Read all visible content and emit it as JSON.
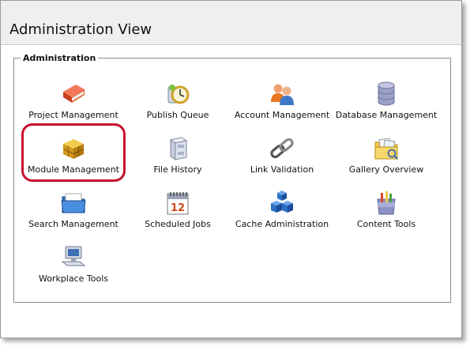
{
  "header": {
    "title": "Administration View"
  },
  "group": {
    "legend": "Administration"
  },
  "tools": [
    {
      "label": "Project Management",
      "icon": "book-icon"
    },
    {
      "label": "Publish Queue",
      "icon": "clock-icon"
    },
    {
      "label": "Account Management",
      "icon": "users-icon"
    },
    {
      "label": "Database Management",
      "icon": "database-icon"
    },
    {
      "label": "Module Management",
      "icon": "module-boxes-icon"
    },
    {
      "label": "File History",
      "icon": "file-cabinet-icon"
    },
    {
      "label": "Link Validation",
      "icon": "chain-link-icon"
    },
    {
      "label": "Gallery Overview",
      "icon": "gallery-folder-icon"
    },
    {
      "label": "Search Management",
      "icon": "search-folder-icon"
    },
    {
      "label": "Scheduled Jobs",
      "icon": "calendar-icon"
    },
    {
      "label": "Cache Administration",
      "icon": "cache-cubes-icon"
    },
    {
      "label": "Content Tools",
      "icon": "content-tools-icon"
    },
    {
      "label": "Workplace Tools",
      "icon": "computer-icon"
    }
  ],
  "colors": {
    "highlight": "#c8102e",
    "header_bg": "#efefef"
  }
}
